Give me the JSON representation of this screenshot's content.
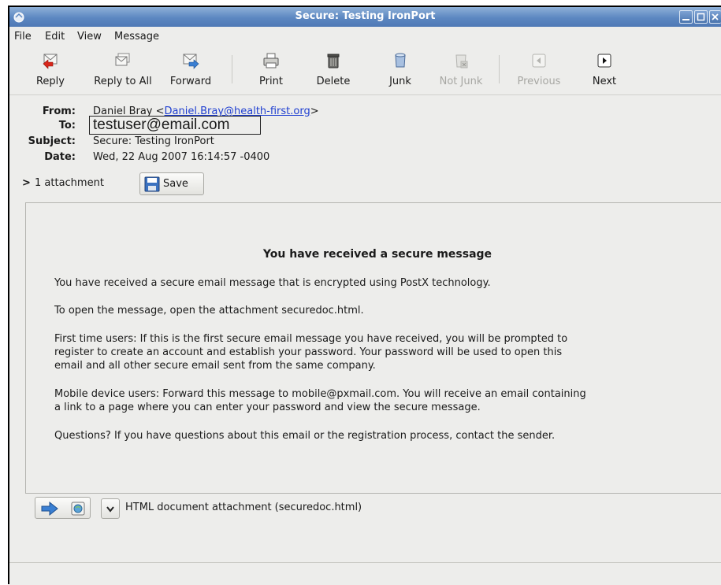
{
  "window": {
    "title": "Secure: Testing IronPort"
  },
  "menu": {
    "items": [
      {
        "label": "File"
      },
      {
        "label": "Edit"
      },
      {
        "label": "View"
      },
      {
        "label": "Message"
      }
    ]
  },
  "toolbar": {
    "reply": {
      "label": "Reply",
      "icon": "reply-icon"
    },
    "reply_all": {
      "label": "Reply to All",
      "icon": "reply-all-icon"
    },
    "forward": {
      "label": "Forward",
      "icon": "forward-icon"
    },
    "print": {
      "label": "Print",
      "icon": "print-icon"
    },
    "delete": {
      "label": "Delete",
      "icon": "trash-icon"
    },
    "junk": {
      "label": "Junk",
      "icon": "junk-icon"
    },
    "not_junk": {
      "label": "Not Junk",
      "icon": "not-junk-icon"
    },
    "previous": {
      "label": "Previous",
      "icon": "previous-icon"
    },
    "next": {
      "label": "Next",
      "icon": "next-icon"
    }
  },
  "headers": {
    "from_label": "From:",
    "from_name": "Daniel Bray <",
    "from_email": "Daniel.Bray@health-first.org",
    "from_close": ">",
    "to_label": "To:",
    "to_value": "testuser@email.com",
    "subject_label": "Subject:",
    "subject_value": "Secure: Testing IronPort",
    "date_label": "Date:",
    "date_value": "Wed, 22 Aug 2007 16:14:57 -0400"
  },
  "attachments_row": {
    "toggle": ">",
    "count_label": "1 attachment",
    "save_label": "Save"
  },
  "message": {
    "heading": "You have received a secure message",
    "p1": "You have received a secure email message that is encrypted using PostX technology.",
    "p2": "To open the message, open the attachment securedoc.html.",
    "p3a": "First time users: If this is the first secure email message you have received, you will be prompted to",
    "p3b": "register to create an account and establish your password. Your password will be used to open this",
    "p3c": "email and all other secure email sent from the same company.",
    "p4a": "Mobile device users: Forward this message to mobile@pxmail.com. You will receive an email containing",
    "p4b": "a link to a page where you can enter your password and view the secure message.",
    "p5": "Questions? If you have questions about this email or the registration process, contact the sender."
  },
  "attachment": {
    "description": "HTML document attachment (securedoc.html)"
  },
  "colors": {
    "titlebar": "#5c87c1",
    "link": "#1f3fd1",
    "background": "#ededeb"
  }
}
